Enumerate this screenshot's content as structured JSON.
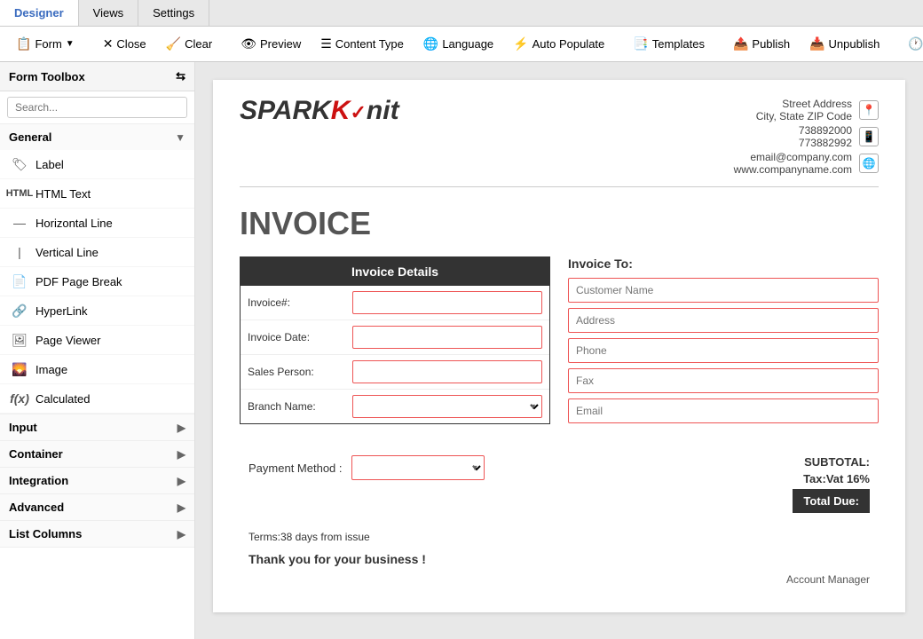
{
  "tabs": [
    {
      "id": "designer",
      "label": "Designer",
      "active": true
    },
    {
      "id": "views",
      "label": "Views",
      "active": false
    },
    {
      "id": "settings",
      "label": "Settings",
      "active": false
    }
  ],
  "toolbar": {
    "form_label": "Form",
    "close_label": "Close",
    "clear_label": "Clear",
    "preview_label": "Preview",
    "content_type_label": "Content Type",
    "language_label": "Language",
    "auto_populate_label": "Auto Populate",
    "templates_label": "Templates",
    "publish_label": "Publish",
    "unpublish_label": "Unpublish",
    "history_label": "History"
  },
  "sidebar": {
    "title": "Form Toolbox",
    "search_placeholder": "Search...",
    "sections": [
      {
        "id": "general",
        "label": "General",
        "expanded": true,
        "items": [
          {
            "id": "label",
            "label": "Label",
            "icon": "🏷"
          },
          {
            "id": "html-text",
            "label": "HTML Text",
            "icon": "📝"
          },
          {
            "id": "horizontal-line",
            "label": "Horizontal Line",
            "icon": "➖"
          },
          {
            "id": "vertical-line",
            "label": "Vertical Line",
            "icon": "⏐"
          },
          {
            "id": "pdf-page-break",
            "label": "PDF Page Break",
            "icon": "📄"
          },
          {
            "id": "hyperlink",
            "label": "HyperLink",
            "icon": "🔗"
          },
          {
            "id": "page-viewer",
            "label": "Page Viewer",
            "icon": "🖼"
          },
          {
            "id": "image",
            "label": "Image",
            "icon": "🌄"
          },
          {
            "id": "calculated",
            "label": "Calculated",
            "icon": "𝑓"
          }
        ]
      },
      {
        "id": "input",
        "label": "Input",
        "expanded": false,
        "items": []
      },
      {
        "id": "container",
        "label": "Container",
        "expanded": false,
        "items": []
      },
      {
        "id": "integration",
        "label": "Integration",
        "expanded": false,
        "items": []
      },
      {
        "id": "advanced",
        "label": "Advanced",
        "expanded": false,
        "items": []
      },
      {
        "id": "list-columns",
        "label": "List Columns",
        "expanded": false,
        "items": []
      }
    ]
  },
  "invoice": {
    "company": {
      "logo_spark": "SPARK",
      "logo_knit": "nit",
      "logo_k": "K",
      "address_line1": "Street Address",
      "address_line2": "City, State ZIP Code",
      "phone1": "738892000",
      "phone2": "773882992",
      "email": "email@company.com",
      "website": "www.companyname.com"
    },
    "title": "INVOICE",
    "details": {
      "header": "Invoice Details",
      "fields": [
        {
          "label": "Invoice#:",
          "type": "input",
          "placeholder": ""
        },
        {
          "label": "Invoice Date:",
          "type": "input",
          "placeholder": ""
        },
        {
          "label": "Sales Person:",
          "type": "input",
          "placeholder": ""
        },
        {
          "label": "Branch Name:",
          "type": "select",
          "placeholder": ""
        }
      ]
    },
    "invoice_to": {
      "label": "Invoice To:",
      "fields": [
        {
          "placeholder": "Customer Name"
        },
        {
          "placeholder": "Address"
        },
        {
          "placeholder": "Phone"
        },
        {
          "placeholder": "Fax"
        },
        {
          "placeholder": "Email"
        }
      ]
    },
    "payment": {
      "label": "Payment Method :"
    },
    "totals": {
      "subtotal_label": "SUBTOTAL:",
      "tax_label": "Tax:Vat 16%",
      "total_due_label": "Total Due:"
    },
    "terms": "Terms:38 days from issue",
    "thankyou": "Thank you for your business !",
    "account_manager": "Account Manager"
  }
}
